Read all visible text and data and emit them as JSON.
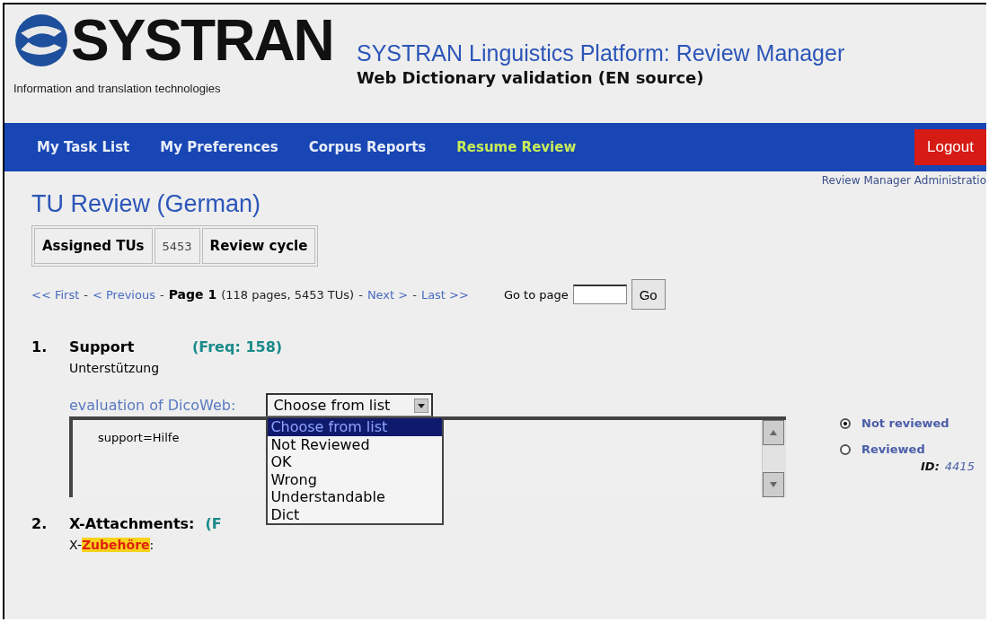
{
  "header": {
    "logo": "SYSTRAN",
    "tagline": "Information and translation technologies",
    "title": "SYSTRAN Linguistics Platform: Review Manager",
    "subtitle": "Web Dictionary validation (EN source)"
  },
  "nav": {
    "items": [
      {
        "label": "My Task List",
        "selected": false
      },
      {
        "label": "My Preferences",
        "selected": false
      },
      {
        "label": "Corpus Reports",
        "selected": false
      },
      {
        "label": "Resume Review",
        "selected": true
      }
    ],
    "logout": "Logout"
  },
  "admin_link": "Review Manager Administratio",
  "page_title": "TU Review (German)",
  "info_table": [
    {
      "text": "Assigned TUs",
      "bold": true
    },
    {
      "text": "5453",
      "bold": false
    },
    {
      "text": "Review cycle",
      "bold": true
    }
  ],
  "pagination": {
    "first": "<< First",
    "sep1": "-",
    "previous": "< Previous",
    "sep2": "-",
    "current": "Page 1",
    "summary": "(118 pages, 5453 TUs)",
    "sep3": "-",
    "next": "Next >",
    "sep4": "-",
    "last": "Last >>",
    "goto_label": "Go to page",
    "go_button": "Go"
  },
  "entries": [
    {
      "number": "1.",
      "term": "Support",
      "freq": "(Freq: 158)",
      "translation_highlight": "Unterstützung",
      "highlighted": false,
      "evaluation_label": "evaluation of DicoWeb:",
      "evaluation_value": "Choose from list",
      "dropdown_open": true,
      "options": [
        {
          "label": "Choose from list",
          "selected": true
        },
        {
          "label": "Not Reviewed",
          "selected": false
        },
        {
          "label": "OK",
          "selected": false
        },
        {
          "label": "Wrong",
          "selected": false
        },
        {
          "label": "Understandable",
          "selected": false
        },
        {
          "label": "Dict",
          "selected": false
        }
      ],
      "comment": "support=Hilfe",
      "status": [
        {
          "label": "Not reviewed",
          "selected": true
        },
        {
          "label": "Reviewed",
          "selected": false
        }
      ],
      "id_label": "ID:",
      "id_value": "4415"
    },
    {
      "number": "2.",
      "term": "X-Attachments:",
      "freq": "(F",
      "translation_prefix": "X-",
      "translation_highlight": "Zubehöre",
      "highlighted": true,
      "translation_suffix": ":"
    }
  ]
}
